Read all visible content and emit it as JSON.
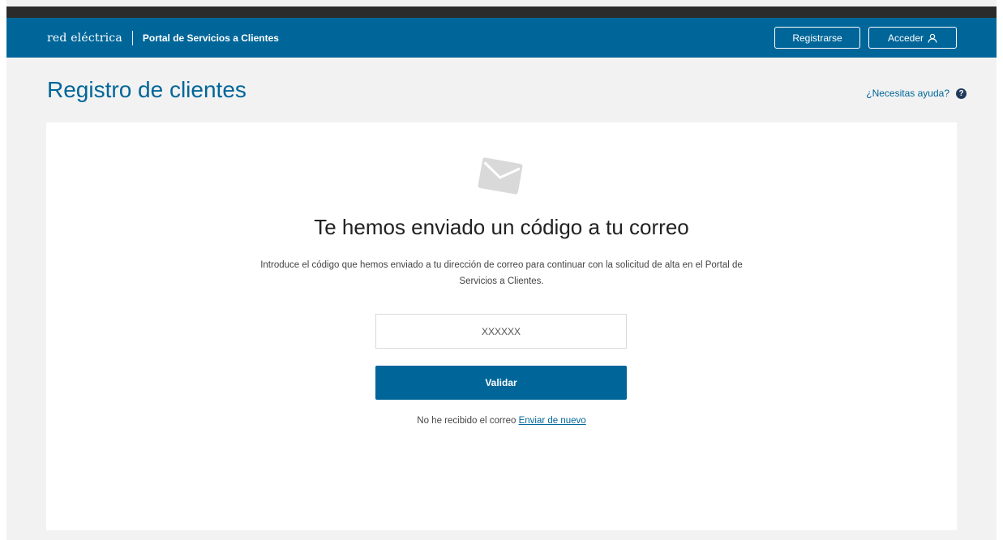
{
  "header": {
    "logo_text": "red eléctrica",
    "portal_title": "Portal de Servicios a Clientes",
    "register_label": "Registrarse",
    "login_label": "Acceder",
    "login_icon": "user-icon",
    "background_color": "#006699"
  },
  "page": {
    "title": "Registro de clientes",
    "help_label": "¿Necesitas ayuda?",
    "help_icon": "question-circle-icon"
  },
  "card": {
    "icon": "envelope-icon",
    "title": "Te hemos enviado un código a tu correo",
    "description": "Introduce el código que hemos enviado a tu dirección de correo para continuar con la solicitud de alta en el Portal de Servicios a Clientes.",
    "code_placeholder": "XXXXXX",
    "validate_label": "Validar",
    "resend_prefix": "No he recibido el correo",
    "resend_link": "Enviar de nuevo"
  },
  "colors": {
    "accent": "#006699",
    "page_background": "#f2f2f2",
    "card_background": "#ffffff"
  }
}
